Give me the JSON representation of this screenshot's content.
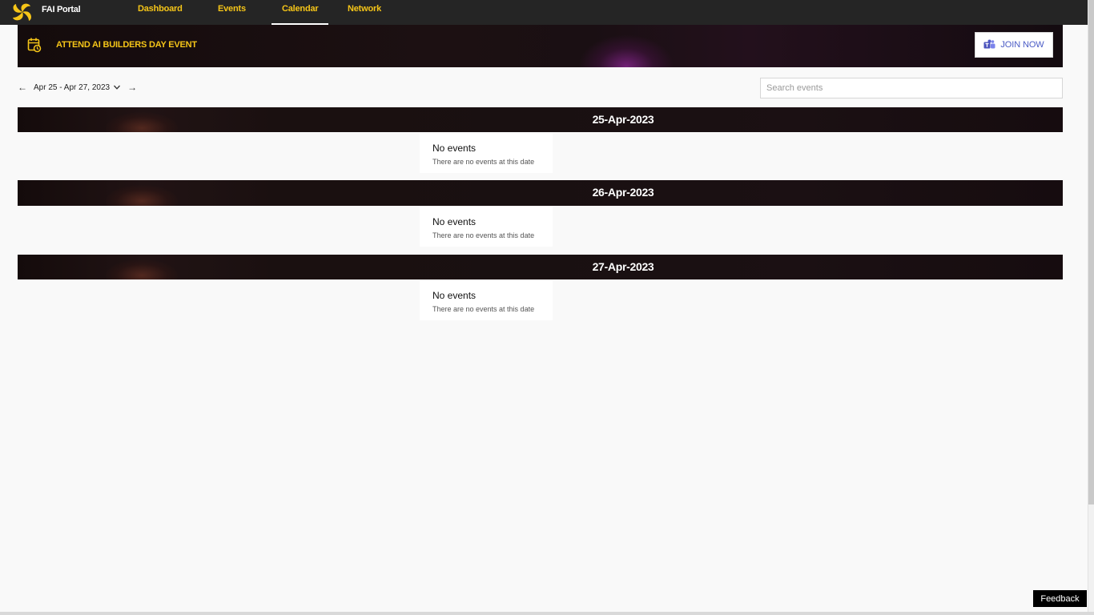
{
  "app": {
    "name": "FAI Portal",
    "logo_icon": "fai-logo-icon"
  },
  "nav": {
    "links": [
      {
        "label": "Dashboard"
      },
      {
        "label": "Events"
      },
      {
        "label": "Calendar",
        "active": true
      },
      {
        "label": "Network"
      }
    ]
  },
  "banner": {
    "icon": "calendar-clock-icon",
    "title": "ATTEND AI BUILDERS DAY EVENT",
    "button_label": "JOIN NOW",
    "button_icon": "teams-icon"
  },
  "date_range": {
    "label": "Apr 25 - Apr 27, 2023",
    "prev_icon": "arrow-left-icon",
    "next_icon": "arrow-right-icon",
    "dropdown_icon": "chevron-down-icon"
  },
  "search": {
    "placeholder": "Search events",
    "value": ""
  },
  "days": [
    {
      "date": "25-Apr-2023",
      "empty_title": "No events",
      "empty_subtitle": "There are no events at this date"
    },
    {
      "date": "26-Apr-2023",
      "empty_title": "No events",
      "empty_subtitle": "There are no events at this date"
    },
    {
      "date": "27-Apr-2023",
      "empty_title": "No events",
      "empty_subtitle": "There are no events at this date"
    }
  ],
  "feedback": {
    "label": "Feedback"
  },
  "colors": {
    "accent": "#f5c518",
    "nav_bg": "#252525",
    "teams_blue": "#4a5bc5"
  }
}
